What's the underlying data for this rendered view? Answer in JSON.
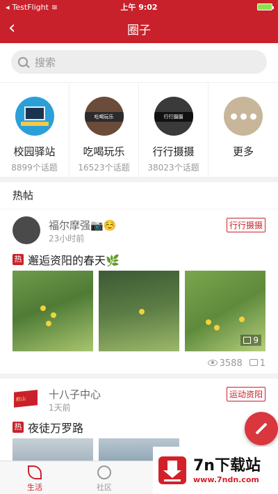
{
  "status_bar": {
    "carrier": "TestFlight",
    "time": "上午 9:02"
  },
  "nav": {
    "back_icon": "‹",
    "title": "圈子"
  },
  "search": {
    "placeholder": "搜索"
  },
  "categories": [
    {
      "name": "校园驿站",
      "count": "8899个话题",
      "icon": "campus-icon"
    },
    {
      "name": "吃喝玩乐",
      "count": "16523个话题",
      "icon": "food-icon",
      "icon_caption": "吃喝玩乐"
    },
    {
      "name": "行行摄摄",
      "count": "38023个话题",
      "icon": "photo-icon",
      "icon_caption": "行行摄摄"
    },
    {
      "name": "更多",
      "count": "",
      "icon": "more-icon"
    }
  ],
  "hot_section": {
    "title": "热帖"
  },
  "posts": [
    {
      "user": "福尔摩强📷☺️",
      "time": "23小时前",
      "tag": "行行摄摄",
      "hot_mark": "热",
      "title": "邂逅资阳的春天🌿",
      "image_count": "9",
      "views": "3588",
      "comments": "1"
    },
    {
      "user": "十八子中心",
      "time": "1天前",
      "tag": "运动资阳",
      "hot_mark": "热",
      "title": "夜徒万罗路",
      "avatar_caption": "航山"
    }
  ],
  "tabs": [
    {
      "label": "生活",
      "active": true
    },
    {
      "label": "社区",
      "active": false
    }
  ],
  "watermark": {
    "main": "7n下载站",
    "url": "www.7ndn.com"
  },
  "colors": {
    "brand_red": "#c9212b",
    "text_gray": "#999999"
  }
}
